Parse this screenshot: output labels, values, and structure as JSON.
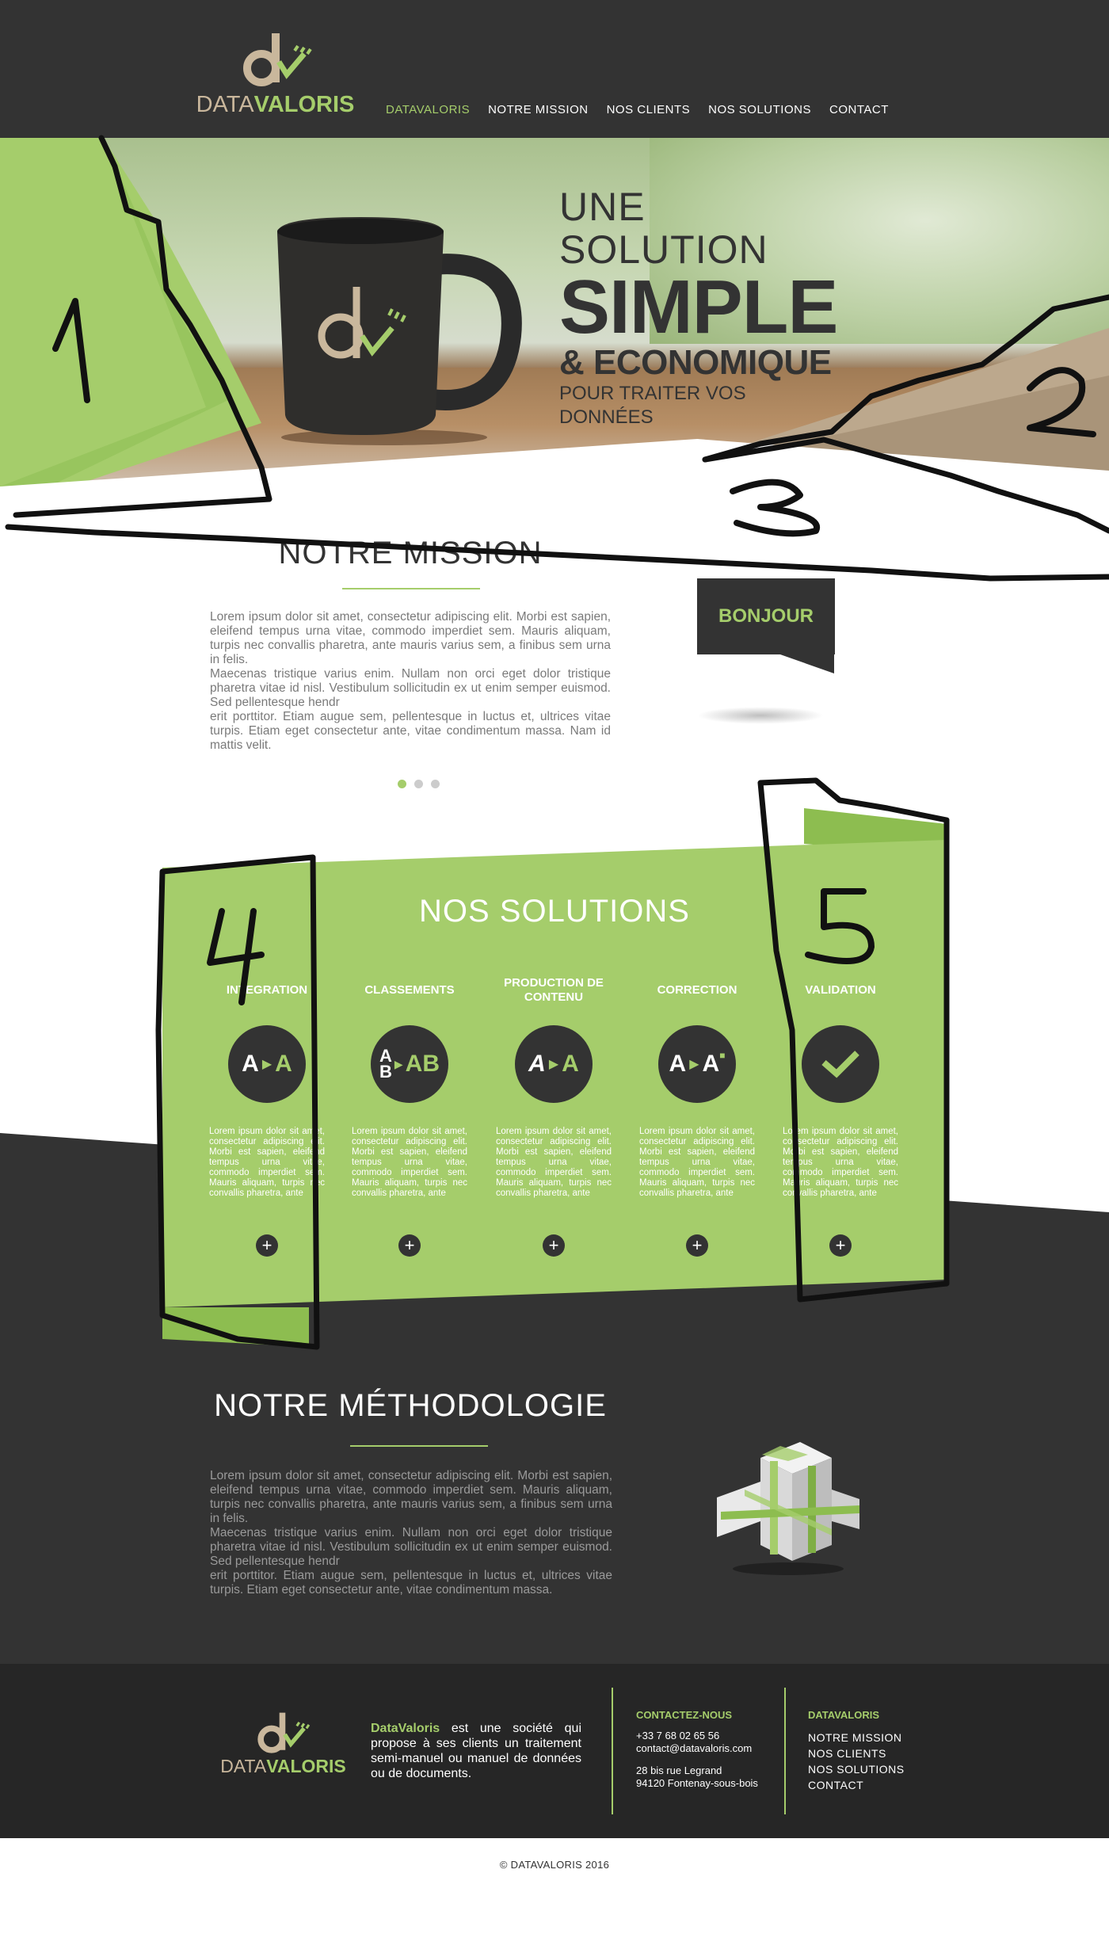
{
  "header": {
    "logo": {
      "text_a": "DATA",
      "text_b": "VALORIS"
    },
    "nav": [
      {
        "label": "DATAVALORIS",
        "active": true
      },
      {
        "label": "NOTRE MISSION",
        "active": false
      },
      {
        "label": "NOS CLIENTS",
        "active": false
      },
      {
        "label": "NOS SOLUTIONS",
        "active": false
      },
      {
        "label": "CONTACT",
        "active": false
      }
    ]
  },
  "hero": {
    "line1": "UNE SOLUTION",
    "line2": "SIMPLE",
    "line3": "& ECONOMIQUE",
    "line4": "POUR TRAITER VOS DONNÉES"
  },
  "mission": {
    "title": "NOTRE MISSION",
    "paragraphs": [
      "Lorem ipsum dolor sit amet, consectetur adipiscing elit. Morbi est sapien, eleifend tempus urna vitae, commodo imperdiet sem. Mauris aliquam, turpis nec convallis pharetra, ante mauris varius sem, a finibus sem urna in felis.",
      "Maecenas tristique varius enim. Nullam non orci eget dolor tristique pharetra vitae id nisl. Vestibulum sollicitudin ex ut enim semper euismod. Sed pellentesque hendr",
      "erit porttitor. Etiam augue sem, pellentesque in luctus et, ultrices vitae turpis. Etiam eget consectetur ante, vitae condimentum massa. Nam id mattis velit."
    ],
    "bubble": "BONJOUR",
    "slider_dots": 3,
    "slider_active": 1
  },
  "solutions": {
    "title": "NOS SOLUTIONS",
    "items": [
      {
        "title": "INTEGRATION",
        "icon": "a-to-a-icon",
        "text": "Lorem ipsum dolor sit amet, consectetur adipiscing elit. Morbi est sapien, eleifend tempus urna vitae, commodo imperdiet sem. Mauris aliquam, turpis nec convallis pharetra, ante"
      },
      {
        "title": "CLASSEMENTS",
        "icon": "ab-sort-icon",
        "text": "Lorem ipsum dolor sit amet, consectetur adipiscing elit. Morbi est sapien, eleifend tempus urna vitae, commodo imperdiet sem. Mauris aliquam, turpis nec convallis pharetra, ante"
      },
      {
        "title": "PRODUCTION DE CONTENU",
        "icon": "a-produce-icon",
        "text": "Lorem ipsum dolor sit amet, consectetur adipiscing elit. Morbi est sapien, eleifend tempus urna vitae, commodo imperdiet sem. Mauris aliquam, turpis nec convallis pharetra, ante"
      },
      {
        "title": "CORRECTION",
        "icon": "a-correct-icon",
        "text": "Lorem ipsum dolor sit amet, consectetur adipiscing elit. Morbi est sapien, eleifend tempus urna vitae, commodo imperdiet sem. Mauris aliquam, turpis nec convallis pharetra, ante"
      },
      {
        "title": "VALIDATION",
        "icon": "checkmark-icon",
        "text": "Lorem ipsum dolor sit amet, consectetur adipiscing elit. Morbi est sapien, eleifend tempus urna vitae, commodo imperdiet sem. Mauris aliquam, turpis nec convallis pharetra, ante"
      }
    ],
    "more": "+"
  },
  "methodologie": {
    "title": "NOTRE MÉTHODOLOGIE",
    "paragraphs": [
      "Lorem ipsum dolor sit amet, consectetur adipiscing elit. Morbi est sapien, eleifend tempus urna vitae, commodo imperdiet sem. Mauris aliquam, turpis nec convallis pharetra, ante mauris varius sem, a finibus sem urna in felis.",
      "Maecenas tristique varius enim. Nullam non orci eget dolor tristique pharetra vitae id nisl. Vestibulum sollicitudin ex ut enim semper euismod. Sed pellentesque hendr",
      "erit porttitor. Etiam augue sem, pellentesque in luctus et, ultrices vitae turpis. Etiam eget consectetur ante, vitae condimentum massa."
    ]
  },
  "footer": {
    "logo": {
      "text_a": "DATA",
      "text_b": "VALORIS"
    },
    "about_brand": "DataValoris",
    "about_text": " est une société qui propose à ses clients un traitement semi-manuel ou manuel de données ou de documents.",
    "contact_title": "CONTACTEZ-NOUS",
    "phone": "+33 7 68 02 65 56",
    "email": "contact@datavaloris.com",
    "address1": "28 bis rue Legrand",
    "address2": "94120 Fontenay-sous-bois",
    "links_title": "DATAVALORIS",
    "links": [
      "NOTRE MISSION",
      "NOS CLIENTS",
      "NOS SOLUTIONS",
      "CONTACT"
    ],
    "copyright": "© DATAVALORIS 2016"
  },
  "annotations": {
    "marks": [
      "1",
      "2",
      "3",
      "4",
      "5"
    ]
  },
  "colors": {
    "green": "#a5cd6b",
    "dark": "#333333",
    "beige": "#c9b79c"
  }
}
